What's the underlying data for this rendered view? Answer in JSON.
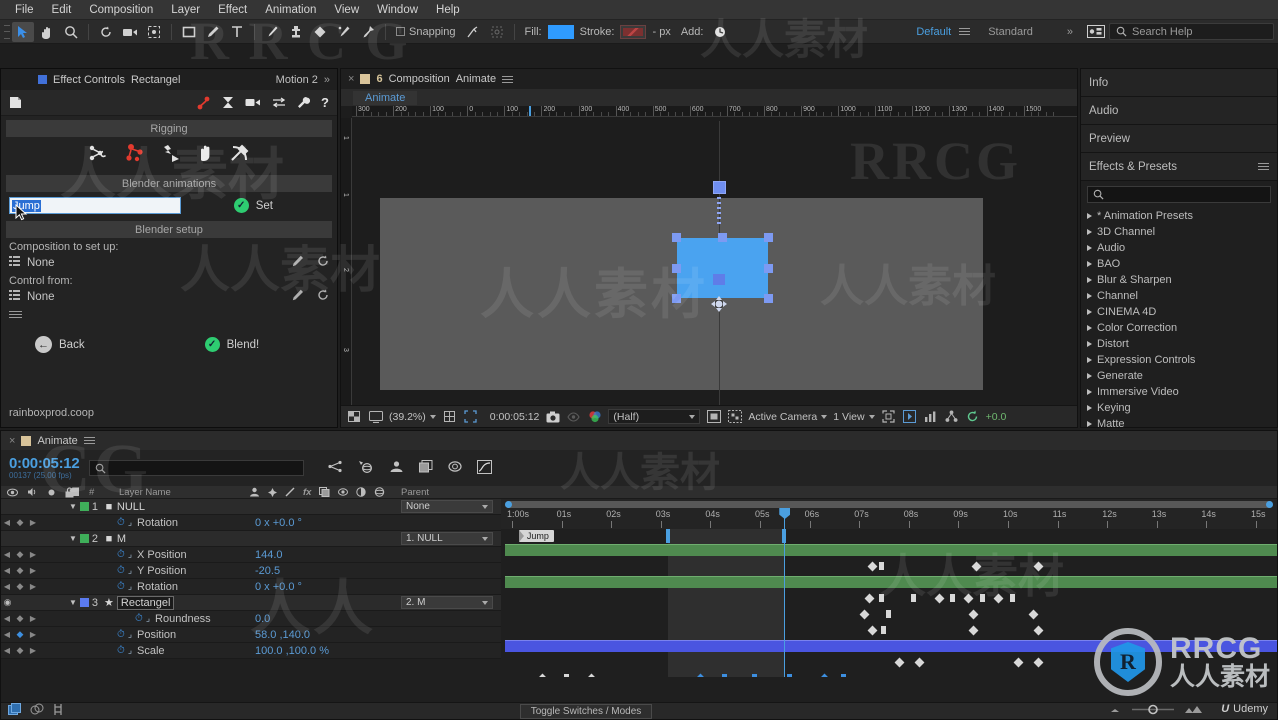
{
  "menu": {
    "items": [
      "File",
      "Edit",
      "Composition",
      "Layer",
      "Effect",
      "Animation",
      "View",
      "Window",
      "Help"
    ]
  },
  "toolbar": {
    "snapping_label": "Snapping",
    "fill_label": "Fill:",
    "stroke_label": "Stroke:",
    "stroke_width": "-  px",
    "add_label": "Add:",
    "workspace": "Default",
    "workspace_mode": "Standard",
    "chevrons": "»",
    "search_help_placeholder": "Search Help",
    "accent_blue": "#2f9bff"
  },
  "effect_controls": {
    "tab_label": "Effect Controls",
    "tab_layer": "Rectangel",
    "tab_comp": "Motion 2",
    "collapse": "»",
    "section_rigging": "Rigging",
    "section_blender_animations": "Blender animations",
    "section_blender_setup": "Blender setup",
    "name_input_value": "Jump",
    "set_label": "Set",
    "comp_to_setup_label": "Composition to set up:",
    "comp_to_setup_value": "None",
    "control_from_label": "Control from:",
    "control_from_value": "None",
    "back_label": "Back",
    "blend_label": "Blend!",
    "footer": "rainboxprod.coop"
  },
  "composition": {
    "tab_prefix": "Composition",
    "tab_name": "Animate",
    "sub_tab": "Animate",
    "ruler_h_labels": [
      "300",
      "200",
      "100",
      "0",
      "100",
      "200",
      "300",
      "400",
      "500",
      "600",
      "700",
      "800",
      "900",
      "1000",
      "1100",
      "1200",
      "1300",
      "1400",
      "1500"
    ],
    "ruler_v_labels": [
      "1",
      "1",
      "2",
      "3"
    ],
    "bottom": {
      "zoom": "(39.2%)",
      "time": "0:00:05:12",
      "resolution": "(Half)",
      "view_layout_label": "1 View",
      "camera": "Active Camera",
      "exposure": "+0.0"
    }
  },
  "right_rail": {
    "sections": [
      "Info",
      "Audio",
      "Preview"
    ],
    "effects_presets_title": "Effects & Presets",
    "search_placeholder": "",
    "categories": [
      "* Animation Presets",
      "3D Channel",
      "Audio",
      "BAO",
      "Blur & Sharpen",
      "Channel",
      "CINEMA 4D",
      "Color Correction",
      "Distort",
      "Expression Controls",
      "Generate",
      "Immersive Video",
      "Keying",
      "Matte"
    ]
  },
  "timeline": {
    "tab_name": "Animate",
    "current_time": "0:00:05:12",
    "current_frame": "00137 (25.00 fps)",
    "search_placeholder": "",
    "columns": {
      "num": "#",
      "layer_name": "Layer Name",
      "parent": "Parent"
    },
    "toggle_switches_label": "Toggle Switches / Modes",
    "marker_label": "Jump",
    "ruler_labels": [
      "1:00s",
      "01s",
      "02s",
      "03s",
      "04s",
      "05s",
      "06s",
      "07s",
      "08s",
      "09s",
      "10s",
      "11s",
      "12s",
      "13s",
      "14s",
      "15s"
    ],
    "layers": [
      {
        "index": "1",
        "name": "NULL",
        "color": "#3faf5a",
        "parent": "None",
        "props": [
          {
            "name": "Rotation",
            "value": "0 x +0.0 °"
          }
        ]
      },
      {
        "index": "2",
        "name": "M",
        "color": "#3faf5a",
        "parent": "1. NULL",
        "props": [
          {
            "name": "X Position",
            "value": "144.0"
          },
          {
            "name": "Y Position",
            "value": "-20.5"
          },
          {
            "name": "Rotation",
            "value": "0 x +0.0 °"
          }
        ]
      },
      {
        "index": "3",
        "name": "Rectangel",
        "color": "#5b7bf0",
        "parent": "2. M",
        "props": [
          {
            "name": "Roundness",
            "value": "0.0"
          },
          {
            "name": "Position",
            "value": "58.0 ,140.0"
          },
          {
            "name": "Scale",
            "value": "100.0 ,100.0 %"
          }
        ]
      }
    ]
  },
  "watermark": {
    "brand": "RRCG",
    "brand_cn": "人人素材",
    "udemy": "Udemy",
    "bg_texts": [
      "RRCG",
      "人人素材"
    ]
  }
}
